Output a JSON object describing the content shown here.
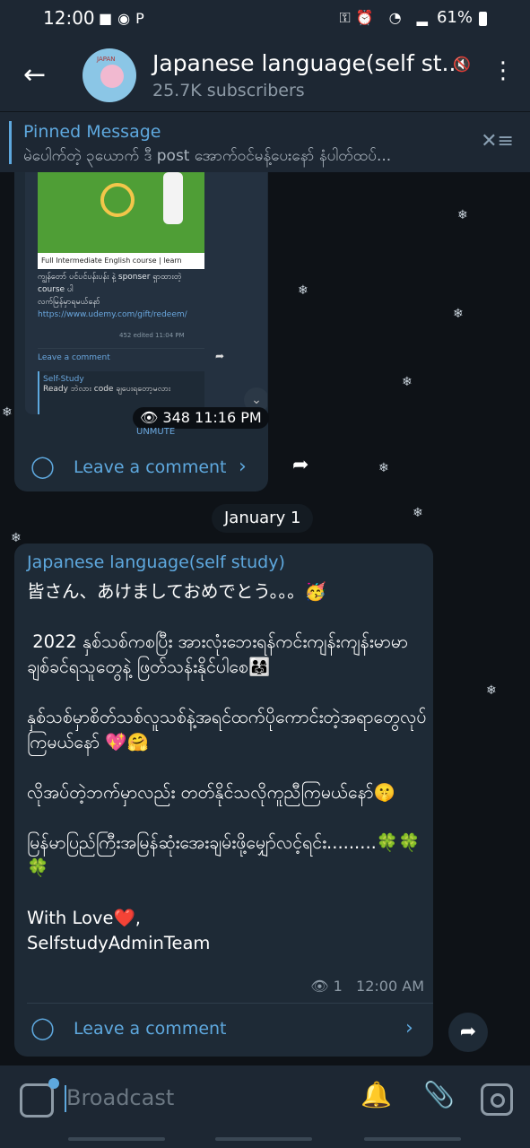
{
  "status_bar": {
    "time": "12:00",
    "battery": "61%"
  },
  "header": {
    "back_icon": "arrow-left-icon",
    "title": "Japanese language(self st...",
    "subscribers": "25.7K subscribers",
    "avatar_text": "JAPAN"
  },
  "pinned": {
    "title": "Pinned Message",
    "text": "မဲပေါက်တဲ့ ၃ယောက် ဒီ post အောက်ဝင်မန့်ပေးနော် နံပါတ်ထပ်..."
  },
  "message1": {
    "screenshot_caption": "Full Intermediate English course | learn",
    "screenshot_text": "ကျွန်တော် ပင်ပင်ပန်းပန်း နဲ့ sponser ရှာထားတဲ့ course ပါ",
    "screenshot_line2": "လက်မြန်မှာရမယ်နော်",
    "screenshot_link": "https://www.udemy.com/gift/redeem/",
    "screenshot_meta": "452  edited 11:04 PM",
    "screenshot_comment": "Leave a comment",
    "reply_name": "Self-Study",
    "reply_text": "Ready ဘဲလား code ချပေးရတော့မလား",
    "views": "348",
    "time": "11:16 PM",
    "unmute": "UNMUTE",
    "comment_label": "Leave a comment"
  },
  "date_separator": "January 1",
  "message2": {
    "sender": "Japanese language(self study)",
    "body": "皆さん、あけましておめでとう。。。🥳\n\n 2022 နှစ်သစ်ကစပြီး အားလုံးဘေးရန်ကင်းကျန်းကျန်းမာမာ ချစ်ခင်ရသူတွေနဲ့ ဖြတ်သန်းနိုင်ပါစေ👨‍👩‍👧\n\nနှစ်သစ်မှာစိတ်သစ်လူသစ်နဲ့အရင်ထက်ပိုကောင်းတဲ့အရာတွေလုပ်ကြမယ်နော် 💖🤗\n\nလိုအပ်တဲ့ဘက်မှာလည်း တတ်နိုင်သလိုကူညီကြမယ်နော်🤫\n\nမြန်မာပြည်ကြီးအမြန်ဆုံးအေးချမ်းဖို့မျှော်လင့်ရင်း.........🍀🍀🍀\n\nWith Love❤️,\nSelfstudyAdminTeam",
    "views": "1",
    "time": "12:00 AM",
    "comment_label": "Leave a comment"
  },
  "input": {
    "placeholder": "Broadcast"
  },
  "colors": {
    "accent": "#5ea8de",
    "panel": "#1d2733",
    "bubble": "#1e2a36"
  }
}
